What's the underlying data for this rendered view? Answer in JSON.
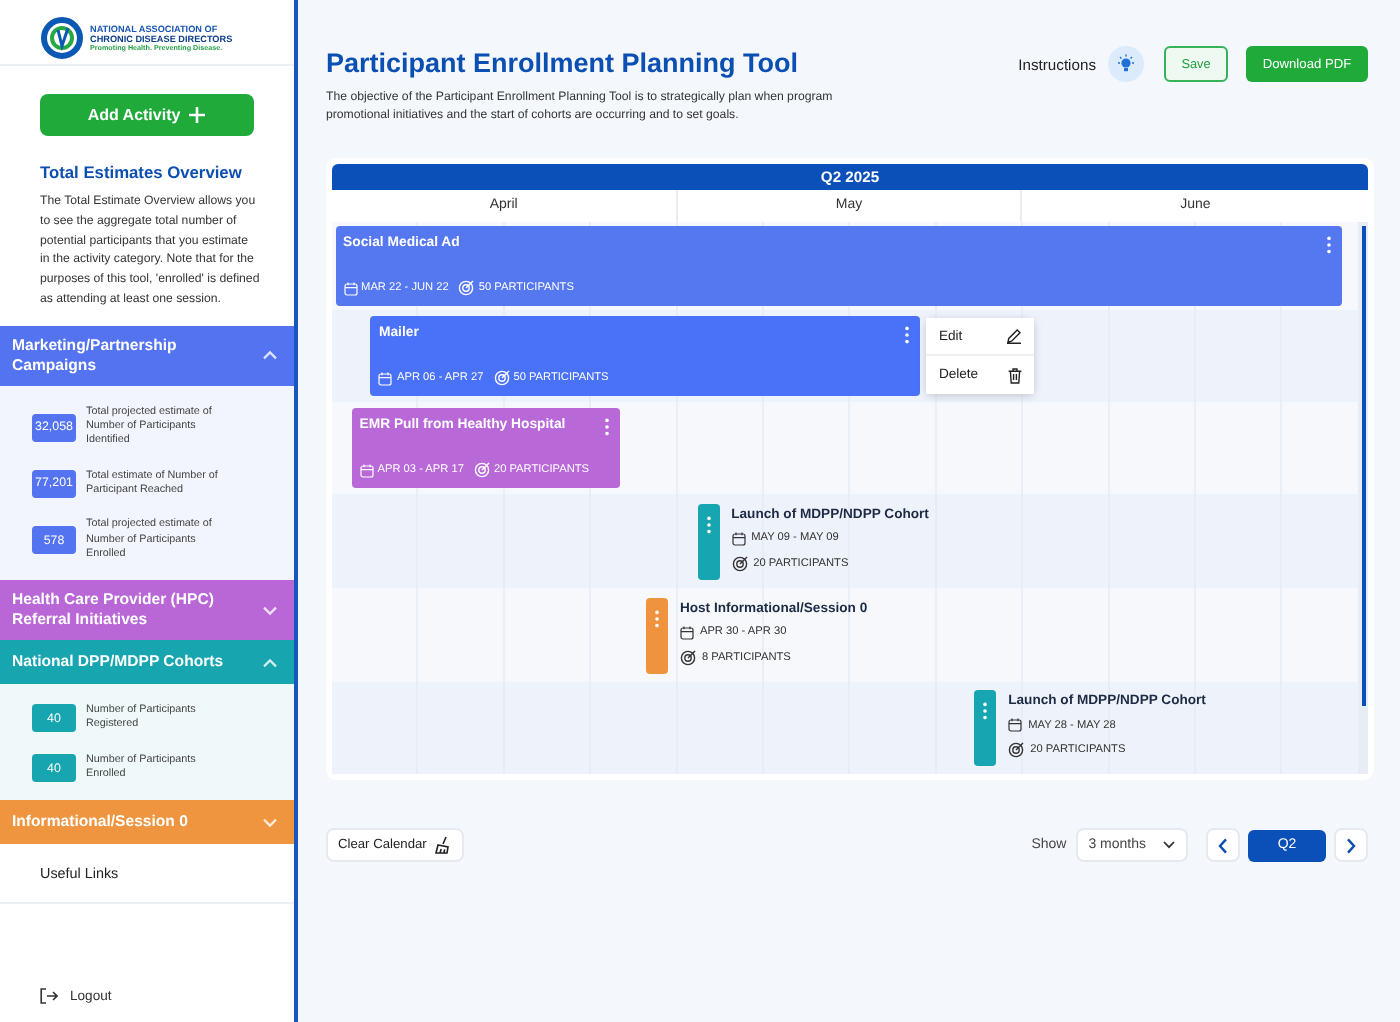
{
  "sidebar": {
    "logo": {
      "org_line_1": "NATIONAL ASSOCIATION OF",
      "org_line_2": "CHRONIC DISEASE DIRECTORS",
      "tagline": "Promoting Health. Preventing Disease."
    },
    "add_button": "Add Activity",
    "overview": {
      "title": "Total Estimates Overview",
      "text": "The Total Estimate Overview allows you to see the aggregate total number of potential participants that you estimate in the activity category. Note that for the purposes of this tool, 'enrolled' is defined as attending at least one session."
    },
    "sections": [
      {
        "title": "Marketing/Partnership Campaigns",
        "color": "#5473f0",
        "expanded": true,
        "stats": [
          {
            "value": "32,058",
            "label": "Total projected estimate of Number of Participants Identified"
          },
          {
            "value": "77,201",
            "label": "Total estimate of Number of Participant Reached"
          },
          {
            "value": "578",
            "label": "Total projected estimate of Number of Participants Enrolled"
          }
        ]
      },
      {
        "title": "Health Care Provider (HPC) Referral Initiatives",
        "color": "#b967d7",
        "expanded": false
      },
      {
        "title": "National DPP/MDPP Cohorts",
        "color": "#17a5b0",
        "expanded": true,
        "stats": [
          {
            "value": "40",
            "label": "Number of Participants Registered"
          },
          {
            "value": "40",
            "label": "Number of Participants Enrolled"
          }
        ]
      },
      {
        "title": "Informational/Session 0",
        "color": "#f0953f",
        "expanded": false
      }
    ],
    "links": [
      "Useful Links"
    ],
    "logout": "Logout"
  },
  "header": {
    "title": "Participant Enrollment Planning Tool",
    "description": "The objective of the Participant Enrollment Planning Tool is to strategically plan when program promotional initiatives and the start of cohorts are occurring and to set goals.",
    "instructions": "Instructions",
    "save": "Save",
    "download": "Download PDF"
  },
  "calendar": {
    "quarter": "Q2 2025",
    "months": [
      "April",
      "May",
      "June"
    ],
    "activities": [
      {
        "kind": "bar",
        "title": "Social Medical Ad",
        "dates": "MAR 22 - JUN 22",
        "participants": "50 PARTICIPANTS",
        "color": "#5577f0",
        "menu_open": false
      },
      {
        "kind": "bar",
        "title": "Mailer",
        "dates": "APR 06 - APR 27",
        "participants": "50 PARTICIPANTS",
        "color": "#4a72f8",
        "menu_open": true
      },
      {
        "kind": "bar",
        "title": "EMR Pull from Healthy Hospital",
        "dates": "APR 03 - APR 17",
        "participants": "20 PARTICIPANTS",
        "color": "#b968d8",
        "menu_open": false
      },
      {
        "kind": "tab",
        "title": "Launch of MDPP/NDPP Cohort",
        "dates": "MAY 09 - MAY 09",
        "participants": "20 PARTICIPANTS",
        "color": "#17a6b1",
        "menu_open": false
      },
      {
        "kind": "tab",
        "title": "Host Informational/Session 0",
        "dates": "APR 30 - APR 30",
        "participants": "8 PARTICIPANTS",
        "color": "#f0933f",
        "menu_open": false
      },
      {
        "kind": "tab",
        "title": "Launch of MDPP/NDPP Cohort",
        "dates": "MAY 28 - MAY 28",
        "participants": "20 PARTICIPANTS",
        "color": "#17a6b1",
        "menu_open": false
      }
    ],
    "menu": [
      {
        "kind": "edit",
        "label": "Edit"
      },
      {
        "kind": "delete",
        "label": "Delete"
      }
    ]
  },
  "footer": {
    "clear": "Clear Calendar",
    "show_label": "Show",
    "range": "3 months",
    "period": "Q2"
  }
}
